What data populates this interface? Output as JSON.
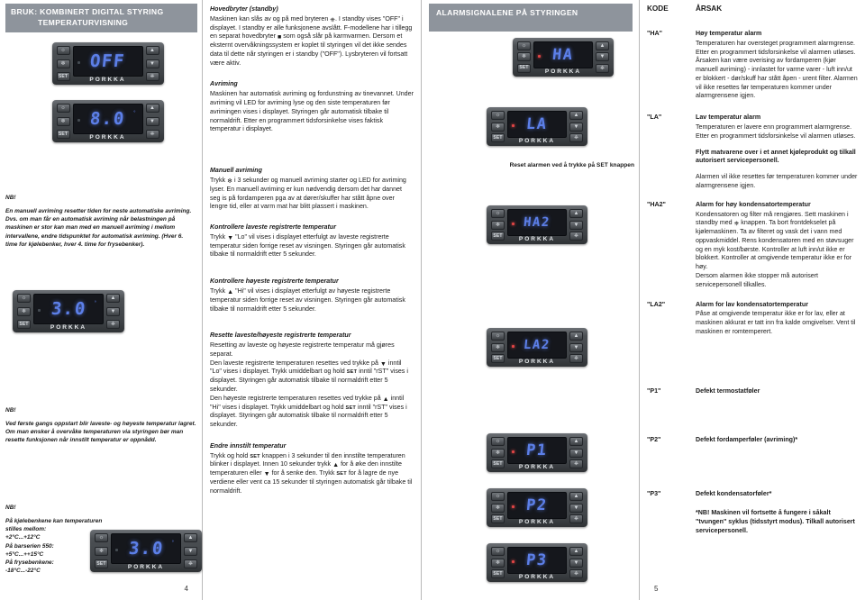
{
  "left": {
    "banner_line1": "BRUK: KOMBINERT DIGITAL STYRING",
    "banner_line2": "TEMPERATURVISNING",
    "display_off": "OFF",
    "display_80": "8.0",
    "display_30a": "3.0",
    "display_30b": "3.0",
    "brand": "PORKKA",
    "nb1_title": "NB!",
    "nb1_body": "En manuell avriming resetter tiden for neste automatiske avriming. Dvs. om man får en automatisk avriming når belastningen på maskinen er stor kan man med en manuell avriming i mellom intervallene, endre tidspunktet for automatisk avriming. (Hver 6. time for kjølebenker, hver 4. time for frysebenker).",
    "nb2_title": "NB!",
    "nb2_body": "Ved første gangs oppstart blir laveste- og høyeste temperatur lagret. Om man ønsker å overvåke temperaturen via styringen bør man resette funksjonen når innstilt temperatur er oppnådd.",
    "nb3_title": "NB!",
    "nb3_lines": [
      "På kjølebenkene kan temperaturen stilles mellom:",
      "+2°C...+12°C",
      "På barserien 550:",
      "+5°C...++15°C",
      "På frysebenkene:",
      "-18°C...-22°C"
    ],
    "page_number": "4"
  },
  "middle": {
    "s1_title": "Hovedbryter (standby)",
    "s1_p1_a": "Maskinen kan slås av og på med bryteren",
    "s1_p1_b": ". I standby vises \"OFF\" i displayet. I standby er alle funksjonene avslått. F-modellene har i tillegg en separat hovedbryter",
    "s1_p1_c": "som også slår på karmvarmen. Dersom et eksternt overvåkningssystem er koplet til styringen vil det ikke sendes data til dette når styringen er i standby (\"OFF\"). Lysbryteren vil fortsatt være aktiv.",
    "s2_title": "Avriming",
    "s2_body": "Maskinen har automatisk avriming og fordunstning av tinevannet. Under avriming vil LED for avriming lyse og den siste temperaturen før avrimingen vises i displayet. Styringen går automatisk tilbake til normaldrift. Etter en programmert tidsforsinkelse vises faktisk temperatur i displayet.",
    "s3_title": "Manuell avriming",
    "s3_a": "Trykk",
    "s3_b": "i 3 sekunder og manuell avriming starter og LED for avriming lyser. En manuell avriming er kun nødvendig dersom det har dannet seg is på fordamperen pga av at dører/skuffer har stått åpne over lengre tid, eller at varm mat har blitt plassert i maskinen.",
    "s4_title": "Kontrollere laveste registrerte temperatur",
    "s4_a": "Trykk",
    "s4_b": "\"Lo\" vil vises i displayet etterfulgt av laveste registrerte temperatur siden forrige reset av visningen. Styringen går automatisk tilbake til normaldrift etter 5 sekunder.",
    "s5_title": "Kontrollere høyeste registrerte temperatur",
    "s5_a": "Trykk",
    "s5_b": "\"Hi\" vil vises i displayet etterfulgt av høyeste registrerte temperatur siden forrige reset av visningen. Styringen går automatisk tilbake til normaldrift etter 5 sekunder.",
    "s6_title": "Resette laveste/høyeste registrerte temperatur",
    "s6_p1": "Resetting av laveste og høyeste registrerte temperatur må gjøres separat.",
    "s6_p2a": "Den laveste registrerte temperaturen resettes ved trykke på",
    "s6_p2b": "inntil \"Lo\" vises i displayet. Trykk umiddelbart og hold",
    "s6_p2c": "inntil \"rST\" vises i displayet. Styringen går automatisk tilbake til normaldrift etter 5 sekunder.",
    "s6_p3a": "Den høyeste registrerte temperaturen resettes ved trykke på",
    "s6_p3b": "inntil \"Hi\" vises i displayet. Trykk umiddelbart og hold",
    "s6_p3c": "inntil \"rST\" vises i displayet. Styringen går automatisk tilbake til normaldrift etter 5 sekunder.",
    "s7_title": "Endre innstilt temperatur",
    "s7_a": "Trykk og hold",
    "s7_b": "knappen i 3 sekunder til den innstilte temperaturen blinker i displayet. Innen 10 sekunder trykk",
    "s7_c": "for å øke den innstilte temperaturen eller",
    "s7_d": "for å senke den. Trykk",
    "s7_e": "for å lagre de nye verdiene eller vent ca 15 sekunder til styringen automatisk går tilbake til normaldrift.",
    "set_key": "SET"
  },
  "alarm_col": {
    "banner": "ALARMSIGNALENE PÅ STYRINGEN",
    "display_ha": "HA",
    "display_la": "LA",
    "display_ha2": "HA2",
    "display_la2": "LA2",
    "display_p1": "P1",
    "display_p2": "P2",
    "display_p3": "P3",
    "brand": "PORKKA",
    "caption_a": "Reset alarmen ved å trykke på",
    "caption_set": "SET",
    "caption_b": "knappen"
  },
  "table": {
    "head_code": "KODE",
    "head_cause": "ÅRSAK",
    "rows": [
      {
        "code": "\"HA\"",
        "title": "Høy temperatur alarm",
        "body": "Temperaturen har oversteget programmert alarmgrense. Etter en programmert tidsforsinkelse vil alarmen utløses. Årsaken kan være overising av fordamperen (kjør manuell avriming) - innlastet for varme varer - luft inn/ut er blokkert - dør/skuff har stått åpen - urent filter. Alarmen vil ikke resettes før temperaturen kommer under alarmgrensene igjen."
      },
      {
        "code": "\"LA\"",
        "title": "Lav temperatur alarm",
        "body": "Temperaturen er lavere enn programmert alarmgrense. Etter en programmert tidsforsinkelse vil alarmen utløses.",
        "bold_note": "Flytt matvarene over i et annet kjøleprodukt og tilkall autorisert servicepersonell.",
        "body2": "Alarmen vil ikke resettes før temperaturen kommer under alarmgrensene igjen."
      },
      {
        "code": "\"HA2\"",
        "title": "Alarm for høy kondensatortemperatur",
        "body_a": "Kondensatoren og filter må rengjøres. Sett maskinen i standby med",
        "body_b": "knappen. Ta bort frontdekselet på kjølemaskinen. Ta av filteret og vask det i vann med oppvaskmiddel. Rens kondensatoren med en støvsuger og en myk kost/børste. Kontroller at luft inn/ut ikke er blokkert. Kontroller at omgivende temperatur ikke er for høy.",
        "body2": "Dersom alarmen ikke stopper må autorisert servicepersonell tilkalles."
      },
      {
        "code": "\"LA2\"",
        "title": "Alarm for lav kondensatortemperatur",
        "body": "Påse at omgivende temperatur ikke er for lav, eller at maskinen akkurat er tatt inn fra kalde omgivelser. Vent til maskinen er romtemperert."
      },
      {
        "code": "\"P1\"",
        "title": "Defekt termostatføler"
      },
      {
        "code": "\"P2\"",
        "title": "Defekt fordamperføler (avriming)*"
      },
      {
        "code": "\"P3\"",
        "title": "Defekt kondensatorføler*",
        "footnote": "*NB! Maskinen vil fortsette å fungere i såkalt \"tvungen\" syklus (tidsstyrt modus). Tilkall autorisert servicepersonell."
      }
    ],
    "page_number": "5"
  }
}
